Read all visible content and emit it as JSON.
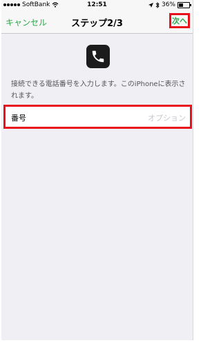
{
  "status_bar": {
    "carrier": "SoftBank",
    "time": "12:51",
    "battery": "36%"
  },
  "nav": {
    "cancel_label": "キャンセル",
    "title": "ステップ2/3",
    "next_label": "次へ"
  },
  "content": {
    "description": "接続できる電話番号を入力します。このiPhoneに表示されます。",
    "field_label": "番号",
    "field_placeholder": "オプション"
  },
  "colors": {
    "accent": "#2aa84a",
    "highlight": "#e8101a",
    "background": "#efeff4"
  }
}
